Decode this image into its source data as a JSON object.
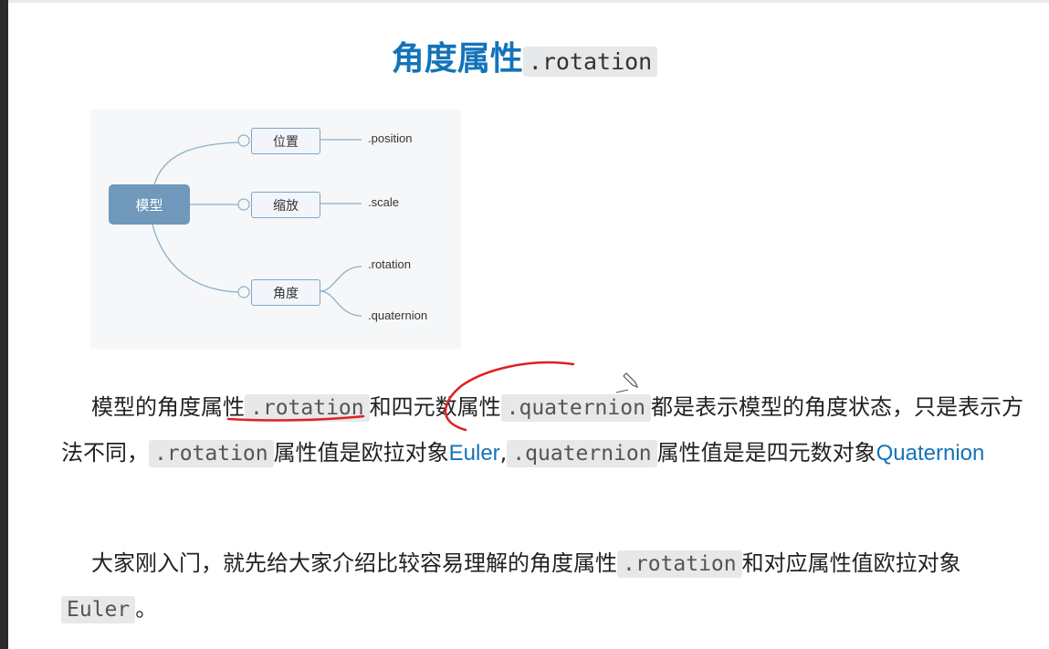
{
  "title": {
    "text": "角度属性",
    "code": ".rotation"
  },
  "mindmap": {
    "root": "模型",
    "branches": [
      {
        "label": "位置",
        "leaves": [
          ".position"
        ]
      },
      {
        "label": "缩放",
        "leaves": [
          ".scale"
        ]
      },
      {
        "label": "角度",
        "leaves": [
          ".rotation",
          ".quaternion"
        ]
      }
    ]
  },
  "paragraph1": {
    "t1": "模型的角度属性",
    "c1": ".rotation",
    "t2": "和四元数属性",
    "c2": ".quaternion",
    "t3": "都是表示模型的角度状态，只是表示方法不同，",
    "c3": ".rotation",
    "t4": "属性值是欧拉对象",
    "link1": "Euler",
    "t5": ",",
    "c4": ".quaternion",
    "t6": "属性值是是四元数对象",
    "link2": "Quaternion"
  },
  "paragraph2": {
    "t1": "大家刚入门，就先给大家介绍比较容易理解的角度属性",
    "c1": ".rotation",
    "t2": "和对应属性值欧拉对象",
    "c2": "Euler",
    "t3": "。"
  },
  "colors": {
    "title_blue": "#1473b9",
    "link_blue": "#1473b9",
    "node_fill": "#6f98bb",
    "annotation_red": "#e02020"
  }
}
